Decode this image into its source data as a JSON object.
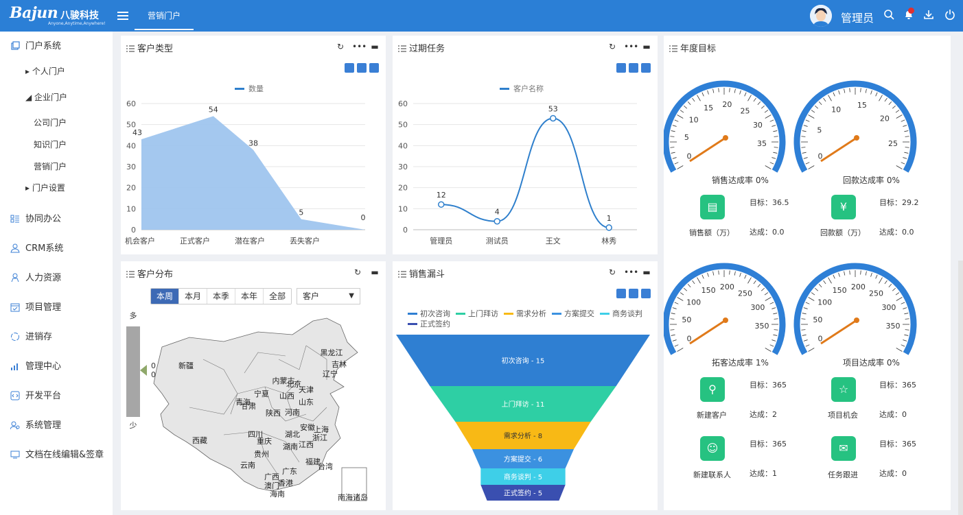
{
  "brand": {
    "logo": "Bajun",
    "logo_cn": "八骏科技",
    "slogan": "Anyone,Anytime,Anywhere!"
  },
  "header": {
    "active_tab": "营销门户",
    "user": "管理员"
  },
  "sidebar": {
    "items": [
      {
        "label": "门户系统",
        "icon": "portal-icon"
      },
      {
        "label": "协同办公",
        "icon": "office-icon"
      },
      {
        "label": "CRM系统",
        "icon": "crm-icon"
      },
      {
        "label": "人力资源",
        "icon": "hr-icon"
      },
      {
        "label": "项目管理",
        "icon": "project-icon"
      },
      {
        "label": "进销存",
        "icon": "inventory-icon"
      },
      {
        "label": "管理中心",
        "icon": "chart-icon"
      },
      {
        "label": "开发平台",
        "icon": "code-icon"
      },
      {
        "label": "系统管理",
        "icon": "users-icon"
      },
      {
        "label": "文档在线编辑&签章",
        "icon": "monitor-icon"
      }
    ],
    "sub": [
      "▸ 个人门户",
      "◢ 企业门户",
      "公司门户",
      "知识门户",
      "营销门户",
      "▸ 门户设置"
    ]
  },
  "panels": {
    "customer_type": "客户类型",
    "overdue": "过期任务",
    "annual": "年度目标",
    "distribution": "客户分布",
    "funnel": "销售漏斗"
  },
  "chart_data": [
    {
      "type": "area",
      "title": "客户类型",
      "legend": [
        "数量"
      ],
      "categories": [
        "机会客户",
        "正式客户",
        "潜在客户",
        "丢失客户"
      ],
      "x": [
        "机会客户",
        "",
        "正式客户",
        "",
        "潜在客户",
        "",
        "丢失客户",
        ""
      ],
      "values": [
        43,
        54,
        38,
        5,
        0
      ],
      "points": [
        [
          0,
          43
        ],
        [
          1.35,
          54
        ],
        [
          2.1,
          38
        ],
        [
          3.0,
          5
        ],
        [
          4.2,
          0
        ]
      ],
      "ylim": [
        0,
        60
      ],
      "yticks": [
        0,
        10,
        20,
        30,
        40,
        50,
        60
      ],
      "color": "#9fc5ee"
    },
    {
      "type": "line",
      "title": "过期任务",
      "legend": [
        "客户名称"
      ],
      "categories": [
        "管理员",
        "测试员",
        "王文",
        "林秀"
      ],
      "values": [
        12,
        4,
        53,
        1
      ],
      "ylim": [
        0,
        60
      ],
      "yticks": [
        0,
        10,
        20,
        30,
        40,
        50,
        60
      ],
      "color": "#2e7fcc"
    },
    {
      "type": "funnel",
      "title": "销售漏斗",
      "legend": [
        "初次咨询",
        "上门拜访",
        "需求分析",
        "方案提交",
        "商务谈判",
        "正式签约"
      ],
      "stages": [
        {
          "name": "初次咨询",
          "value": 15,
          "label": "初次咨询 - 15",
          "color": "#2f7fd2"
        },
        {
          "name": "上门拜访",
          "value": 11,
          "label": "上门拜访 - 11",
          "color": "#2ecfa4"
        },
        {
          "name": "需求分析",
          "value": 8,
          "label": "需求分析 - 8",
          "color": "#f8b915"
        },
        {
          "name": "方案提交",
          "value": 6,
          "label": "方案提交 - 6",
          "color": "#3b91e0"
        },
        {
          "name": "商务谈判",
          "value": 5,
          "label": "商务谈判 - 5",
          "color": "#3ecfe8"
        },
        {
          "name": "正式签约",
          "value": 5,
          "label": "正式签约 - 5",
          "color": "#3a4fb0"
        }
      ]
    }
  ],
  "distribution": {
    "periods": [
      "本周",
      "本月",
      "本季",
      "本年",
      "全部"
    ],
    "active_period": "本周",
    "select": "客户",
    "scale_high": "多",
    "scale_low": "少",
    "marker_values": [
      "0",
      "0"
    ],
    "provinces": [
      "黑龙江",
      "吉林",
      "辽宁",
      "新疆",
      "内蒙古",
      "北京",
      "天津",
      "宁夏",
      "山西",
      "青海",
      "甘肃",
      "山东",
      "陕西",
      "河南",
      "西藏",
      "四川",
      "湖北",
      "安徽",
      "上海",
      "浙江",
      "重庆",
      "湖南",
      "江西",
      "贵州",
      "云南",
      "福建",
      "台湾",
      "广西",
      "广东",
      "澳门",
      "香港",
      "海南",
      "南海诸岛"
    ]
  },
  "gauges": [
    {
      "label": "销售达成率 0%",
      "ticks": [
        "0",
        "5",
        "10",
        "15",
        "20",
        "25",
        "30",
        "35"
      ],
      "metric": "销售额（万）",
      "target": "目标：36.5",
      "achieved": "达成：0.0",
      "icon": "sales-doc-icon"
    },
    {
      "label": "回款达成率 0%",
      "ticks": [
        "0",
        "5",
        "10",
        "15",
        "20",
        "25"
      ],
      "metric": "回款额（万）",
      "target": "目标：29.2",
      "achieved": "达成：0.0",
      "icon": "money-bag-icon"
    },
    {
      "label": "拓客达成率 1%",
      "ticks": [
        "0",
        "50",
        "100",
        "150",
        "200",
        "250",
        "300",
        "350"
      ],
      "metric": "新建客户",
      "target": "目标：365",
      "achieved": "达成：2",
      "icon": "new-customer-icon"
    },
    {
      "label": "项目达成率 0%",
      "ticks": [
        "0",
        "50",
        "100",
        "150",
        "200",
        "250",
        "300",
        "350"
      ],
      "metric": "项目机会",
      "target": "目标：365",
      "achieved": "达成：0",
      "icon": "star-icon"
    }
  ],
  "extra_goals": [
    {
      "metric": "新建联系人",
      "target": "目标：365",
      "achieved": "达成：1",
      "icon": "contact-icon"
    },
    {
      "metric": "任务跟进",
      "target": "目标：365",
      "achieved": "达成：0",
      "icon": "task-icon"
    }
  ]
}
